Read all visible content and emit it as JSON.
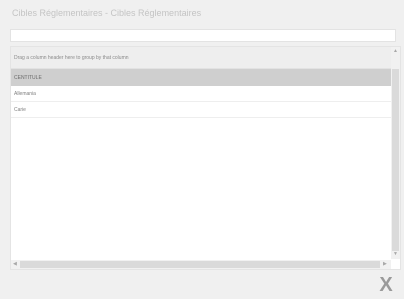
{
  "window": {
    "title": "Cibles Réglementaires - Cibles Réglementaires"
  },
  "search": {
    "value": ""
  },
  "grid": {
    "group_panel_text": "Drag a column header here to group by that column",
    "column_header": "CENTITULE",
    "rows": [
      "Allemania",
      "Carie"
    ]
  },
  "scrollbars": {
    "up_arrow": "▲",
    "down_arrow": "▼",
    "left_arrow": "◀",
    "right_arrow": "▶"
  },
  "footer": {
    "close_label": "X"
  }
}
